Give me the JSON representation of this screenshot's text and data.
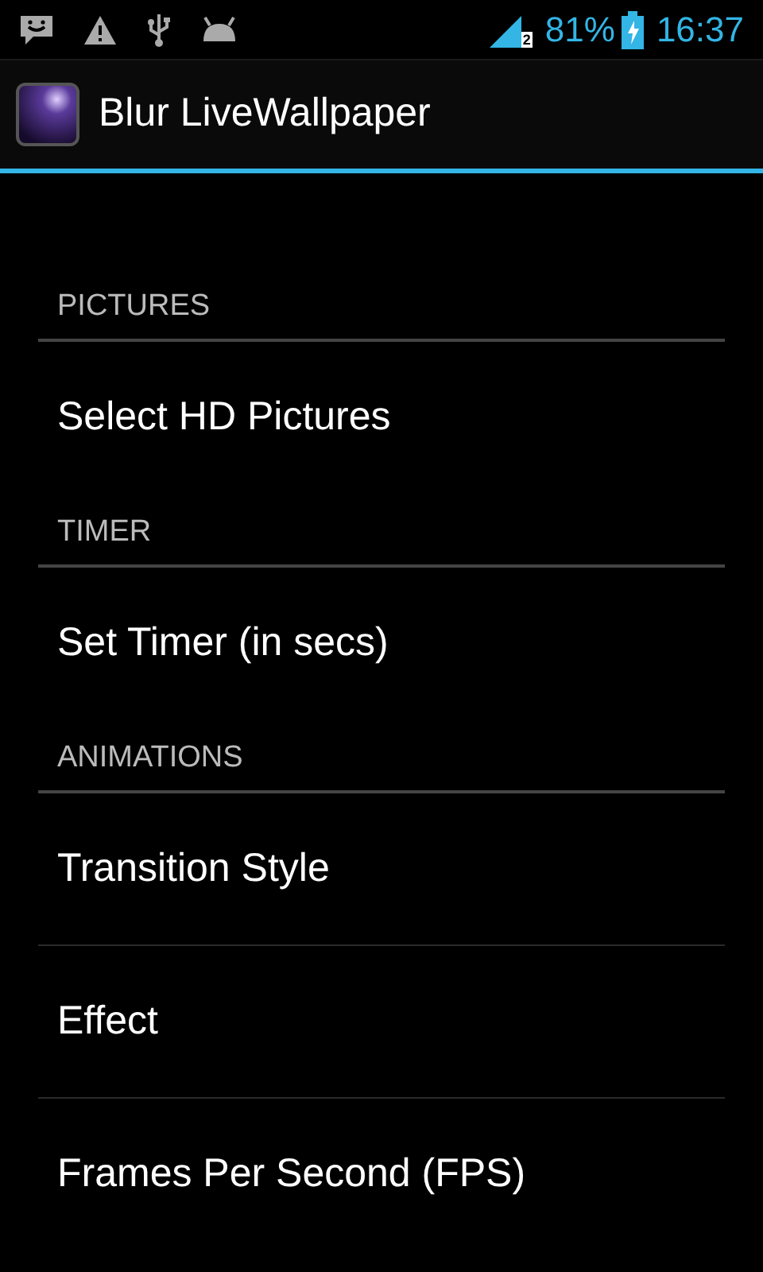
{
  "status_bar": {
    "signal_sim": "2",
    "battery": "81%",
    "time": "16:37"
  },
  "action_bar": {
    "title": "Blur LiveWallpaper"
  },
  "sections": [
    {
      "header": "PICTURES",
      "items": [
        {
          "title": "Select HD Pictures"
        }
      ]
    },
    {
      "header": "TIMER",
      "items": [
        {
          "title": "Set Timer (in secs)"
        }
      ]
    },
    {
      "header": "ANIMATIONS",
      "items": [
        {
          "title": "Transition Style"
        },
        {
          "title": "Effect"
        },
        {
          "title": "Frames Per Second (FPS)"
        }
      ]
    }
  ]
}
